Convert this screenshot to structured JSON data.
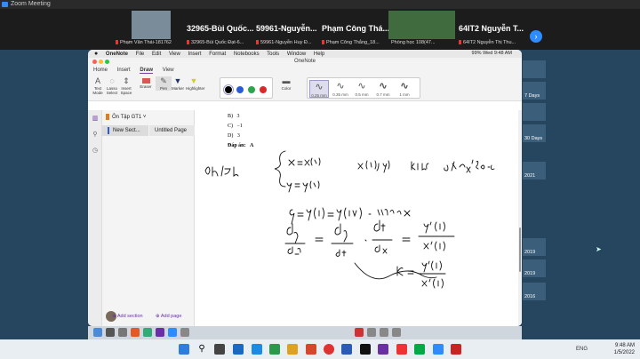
{
  "zoom": {
    "title": "Zoom Meeting"
  },
  "participants": [
    {
      "name": "",
      "label": "Phạm Văn Thái-181762",
      "thumb": true
    },
    {
      "name": "32965-Bùi Quốc...",
      "label": "32965-Bùi Quốc Đạt-6..."
    },
    {
      "name": "59961-Nguyễn...",
      "label": "59961-Nguyễn Huy Đ..."
    },
    {
      "name": "Phạm Công Thá...",
      "label": "Phạm Công Thắng_18..."
    },
    {
      "name": "",
      "label": "Phòng học 108(47...",
      "thumb": true,
      "green": true
    },
    {
      "name": "64IT2 Nguyễn T...",
      "label": "64IT2 Nguyễn Thị Thu..."
    }
  ],
  "mac": {
    "menu": [
      "OneNote",
      "File",
      "Edit",
      "View",
      "Insert",
      "Format",
      "Notebooks",
      "Tools",
      "Window",
      "Help"
    ],
    "status": "99%  Wed 9:48 AM"
  },
  "onenote": {
    "title": "OneNote",
    "tabs": [
      "Home",
      "Insert",
      "Draw",
      "View"
    ],
    "active_tab": "Draw",
    "tools": [
      "Text Mode",
      "Lasso Select",
      "Insert Space",
      "Eraser",
      "Pen",
      "Marker",
      "Highlighter"
    ],
    "custom_color": "Color",
    "thicknesses": [
      "0.25 mm",
      "0.35 mm",
      "0.5 mm",
      "0.7 mm",
      "1 mm"
    ],
    "notebook": "Ôn Tập GT1",
    "section": "New Sect...",
    "page": "Untitled Page",
    "add_section": "Add section",
    "add_page": "Add page",
    "note": {
      "options": [
        {
          "k": "B)",
          "v": "3"
        },
        {
          "k": "C)",
          "v": "−1"
        },
        {
          "k": "D)",
          "v": "3"
        }
      ],
      "answer_label": "Đáp án:",
      "answer": "A"
    }
  },
  "desktop": {
    "icons": [
      "",
      "7 Days",
      "",
      "30 Days",
      "2021",
      "2019",
      "2019",
      "2016"
    ]
  },
  "clock": {
    "time": "9:48 AM",
    "date": "1/5/2022"
  },
  "tray": {
    "lang": "ENG"
  }
}
